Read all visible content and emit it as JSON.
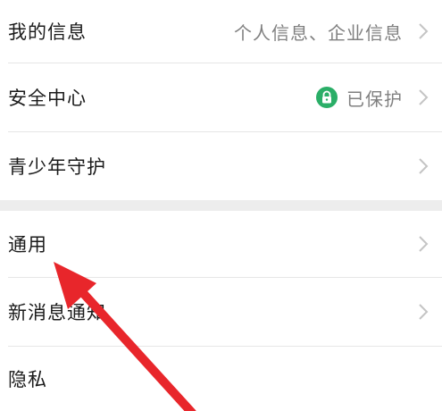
{
  "settings": {
    "items": [
      {
        "label": "我的信息",
        "value": "个人信息、企业信息"
      },
      {
        "label": "安全中心",
        "value": "已保护"
      },
      {
        "label": "青少年守护",
        "value": ""
      },
      {
        "label": "通用",
        "value": ""
      },
      {
        "label": "新消息通知",
        "value": ""
      },
      {
        "label": "隐私",
        "value": ""
      }
    ]
  },
  "icons": {
    "row_chevron": "chevron-right-icon",
    "security_status": "lock-icon",
    "annotation": "red-arrow-icon"
  },
  "colors": {
    "background": "#ffffff",
    "section_gap": "#ededed",
    "divider": "#e6e6e6",
    "text_primary": "#1b1b1b",
    "text_secondary": "#808080",
    "chevron": "#c4c4c4",
    "security_green": "#2aae67",
    "annotation_red": "#e8262b"
  }
}
